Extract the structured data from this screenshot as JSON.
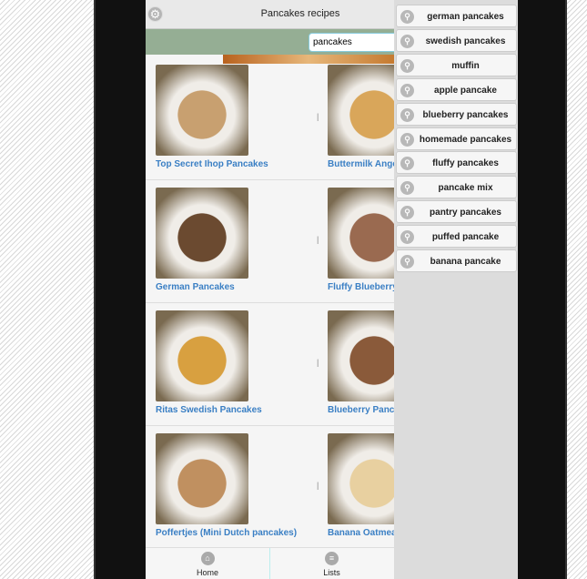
{
  "app": {
    "title": "Pancakes recipes",
    "search_value": "pancakes"
  },
  "recipes": [
    {
      "name": "Top Secret Ihop Pancakes",
      "color": "#c8a070"
    },
    {
      "name": "Buttermilk Angel Pancakes",
      "color": "#d9a65a"
    },
    {
      "name": "German Pancakes",
      "color": "#6b4a30"
    },
    {
      "name": "Fluffy Blueberry Pancakes",
      "color": "#9a6a50"
    },
    {
      "name": "Ritas Swedish Pancakes",
      "color": "#d8a040"
    },
    {
      "name": "Blueberry Pancakes",
      "color": "#8a5a3a"
    },
    {
      "name": "Poffertjes (Mini Dutch pancakes)",
      "color": "#c09060"
    },
    {
      "name": "Banana Oatmeal Pancakes",
      "color": "#e8d0a0"
    }
  ],
  "suggestions": [
    "german pancakes",
    "swedish pancakes",
    "muffin",
    "apple pancake",
    "blueberry pancakes",
    "homemade pancakes",
    "fluffy pancakes",
    "pancake mix",
    "pantry pancakes",
    "puffed pancake",
    "banana pancake"
  ],
  "footer": {
    "home": "Home",
    "lists": "Lists"
  }
}
